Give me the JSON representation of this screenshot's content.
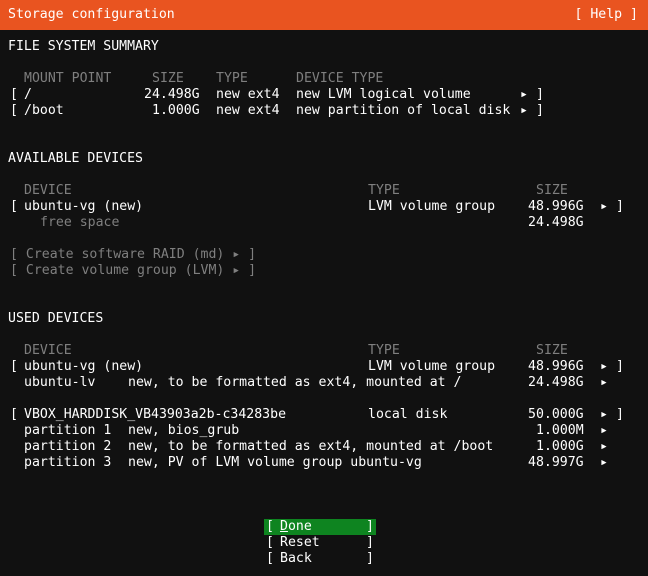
{
  "header": {
    "title": "Storage configuration",
    "help_label": "[ Help ]"
  },
  "fs_summary": {
    "heading": "FILE SYSTEM SUMMARY",
    "columns": {
      "mount_point": "MOUNT POINT",
      "size": "SIZE",
      "type": "TYPE",
      "device_type": "DEVICE TYPE"
    },
    "rows": [
      {
        "mount": "/",
        "size": "24.498G",
        "type": "new ext4",
        "device_type": "new LVM logical volume"
      },
      {
        "mount": "/boot",
        "size": "1.000G",
        "type": "new ext4",
        "device_type": "new partition of local disk"
      }
    ]
  },
  "available": {
    "heading": "AVAILABLE DEVICES",
    "columns": {
      "device": "DEVICE",
      "type": "TYPE",
      "size": "SIZE"
    },
    "vg": {
      "name": "ubuntu-vg (new)",
      "type": "LVM volume group",
      "size": "48.996G"
    },
    "free": {
      "label": "free space",
      "size": "24.498G"
    },
    "actions": {
      "raid": "[ Create software RAID (md) ▸ ]",
      "lvm": "[ Create volume group (LVM) ▸ ]"
    }
  },
  "used": {
    "heading": "USED DEVICES",
    "columns": {
      "device": "DEVICE",
      "type": "TYPE",
      "size": "SIZE"
    },
    "vg": {
      "name": "ubuntu-vg (new)",
      "type": "LVM volume group",
      "size": "48.996G"
    },
    "lv": {
      "name": "ubuntu-lv",
      "desc": "new, to be formatted as ext4, mounted at /",
      "size": "24.498G"
    },
    "disk": {
      "name": "VBOX_HARDDISK_VB43903a2b-c34283be",
      "type": "local disk",
      "size": "50.000G"
    },
    "partitions": [
      {
        "name": "partition 1",
        "desc": "new, bios_grub",
        "size": "1.000M"
      },
      {
        "name": "partition 2",
        "desc": "new, to be formatted as ext4, mounted at /boot",
        "size": "1.000G"
      },
      {
        "name": "partition 3",
        "desc": "new, PV of LVM volume group ubuntu-vg",
        "size": "48.997G"
      }
    ]
  },
  "glyphs": {
    "bracket_open": "[",
    "bracket_close": "]",
    "arrow": "▸"
  },
  "buttons": {
    "done": "Done",
    "reset": "Reset",
    "back": "Back"
  },
  "colors": {
    "accent": "#e95420",
    "focus": "#0e8420",
    "background": "#111111",
    "dim_text": "#7f7f7f"
  }
}
